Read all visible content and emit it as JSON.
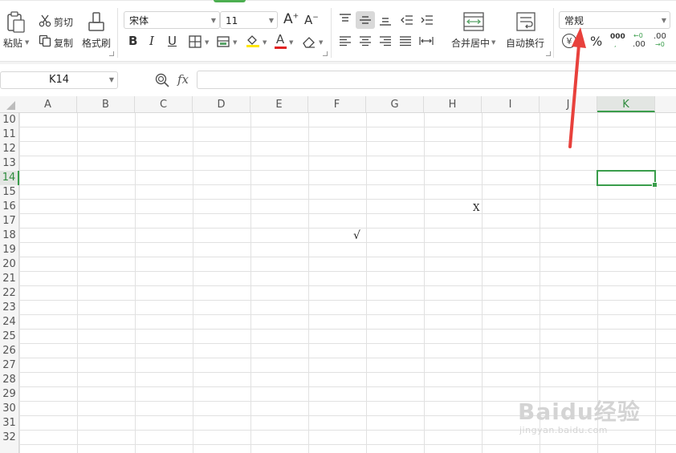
{
  "ribbon": {
    "paste_label": "粘贴",
    "cut_label": "剪切",
    "copy_label": "复制",
    "format_painter_label": "格式刷",
    "font_name": "宋体",
    "font_size": "11",
    "bold_label": "B",
    "italic_label": "I",
    "underline_label": "U",
    "font_color_label": "A",
    "merge_center_label": "合并居中",
    "wrap_text_label": "自动换行",
    "number_format": "常规",
    "currency_symbol": "¥",
    "percent_symbol": "%",
    "thousands_symbol": "000",
    "increase_decimal_label": ".00",
    "decrease_decimal_label": ".00",
    "grow_font_label": "A",
    "shrink_font_label": "A",
    "fill_color": "#ffe600",
    "font_color": "#e02020"
  },
  "formula_bar": {
    "name_box": "K14",
    "fx_label": "fx",
    "formula": ""
  },
  "grid": {
    "columns": [
      "A",
      "B",
      "C",
      "D",
      "E",
      "F",
      "G",
      "H",
      "I",
      "J",
      "K"
    ],
    "rows": [
      "10",
      "11",
      "12",
      "13",
      "14",
      "15",
      "16",
      "17",
      "18",
      "19",
      "20",
      "21",
      "22",
      "23",
      "24",
      "25",
      "26",
      "27",
      "28",
      "29",
      "30",
      "31",
      "32"
    ],
    "selected_column": "K",
    "selected_row": "14",
    "accent_color": "#3a9d4b"
  },
  "stray_marks": {
    "cursor_glyph": "X",
    "check_glyph": "√"
  },
  "watermark": {
    "main": "Baidu经验",
    "sub": "jingyan.baidu.com"
  },
  "annotation": {
    "arrow_color": "#e8413c"
  }
}
